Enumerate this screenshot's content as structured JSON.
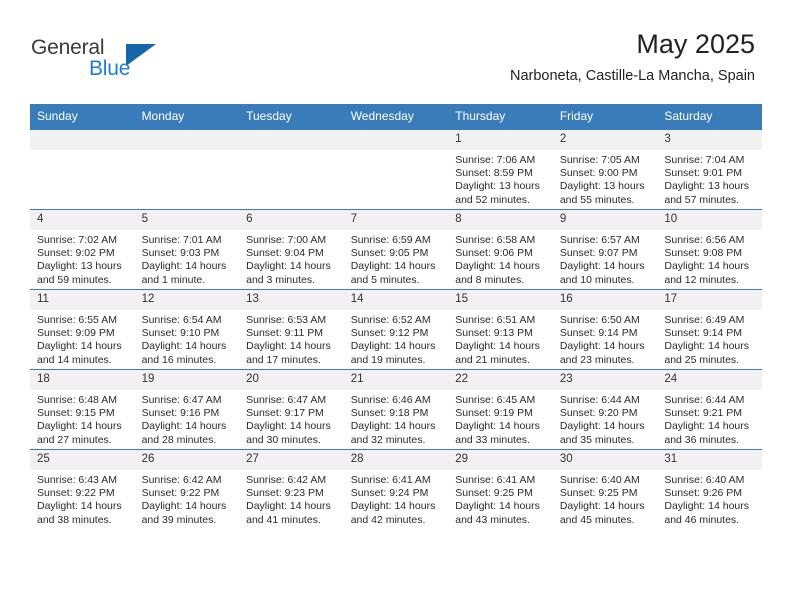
{
  "brand": {
    "name_part1": "General",
    "name_part2": "Blue",
    "accent_color": "#1f7fd0",
    "triangle_color": "#1665a8"
  },
  "header": {
    "title": "May 2025",
    "subtitle": "Narboneta, Castille-La Mancha, Spain"
  },
  "theme": {
    "header_row_color": "#3a7cba",
    "daynum_band_color": "#f1f1f1"
  },
  "weekdays": [
    "Sunday",
    "Monday",
    "Tuesday",
    "Wednesday",
    "Thursday",
    "Friday",
    "Saturday"
  ],
  "labels": {
    "sunrise_prefix": "Sunrise:",
    "sunset_prefix": "Sunset:",
    "daylight_prefix": "Daylight:"
  },
  "weeks": [
    [
      {
        "day": "",
        "empty": true
      },
      {
        "day": "",
        "empty": true
      },
      {
        "day": "",
        "empty": true
      },
      {
        "day": "",
        "empty": true
      },
      {
        "day": "1",
        "sunrise": "Sunrise: 7:06 AM",
        "sunset": "Sunset: 8:59 PM",
        "daylight_line1": "Daylight: 13 hours",
        "daylight_line2": "and 52 minutes."
      },
      {
        "day": "2",
        "sunrise": "Sunrise: 7:05 AM",
        "sunset": "Sunset: 9:00 PM",
        "daylight_line1": "Daylight: 13 hours",
        "daylight_line2": "and 55 minutes."
      },
      {
        "day": "3",
        "sunrise": "Sunrise: 7:04 AM",
        "sunset": "Sunset: 9:01 PM",
        "daylight_line1": "Daylight: 13 hours",
        "daylight_line2": "and 57 minutes."
      }
    ],
    [
      {
        "day": "4",
        "sunrise": "Sunrise: 7:02 AM",
        "sunset": "Sunset: 9:02 PM",
        "daylight_line1": "Daylight: 13 hours",
        "daylight_line2": "and 59 minutes."
      },
      {
        "day": "5",
        "sunrise": "Sunrise: 7:01 AM",
        "sunset": "Sunset: 9:03 PM",
        "daylight_line1": "Daylight: 14 hours",
        "daylight_line2": "and 1 minute."
      },
      {
        "day": "6",
        "sunrise": "Sunrise: 7:00 AM",
        "sunset": "Sunset: 9:04 PM",
        "daylight_line1": "Daylight: 14 hours",
        "daylight_line2": "and 3 minutes."
      },
      {
        "day": "7",
        "sunrise": "Sunrise: 6:59 AM",
        "sunset": "Sunset: 9:05 PM",
        "daylight_line1": "Daylight: 14 hours",
        "daylight_line2": "and 5 minutes."
      },
      {
        "day": "8",
        "sunrise": "Sunrise: 6:58 AM",
        "sunset": "Sunset: 9:06 PM",
        "daylight_line1": "Daylight: 14 hours",
        "daylight_line2": "and 8 minutes."
      },
      {
        "day": "9",
        "sunrise": "Sunrise: 6:57 AM",
        "sunset": "Sunset: 9:07 PM",
        "daylight_line1": "Daylight: 14 hours",
        "daylight_line2": "and 10 minutes."
      },
      {
        "day": "10",
        "sunrise": "Sunrise: 6:56 AM",
        "sunset": "Sunset: 9:08 PM",
        "daylight_line1": "Daylight: 14 hours",
        "daylight_line2": "and 12 minutes."
      }
    ],
    [
      {
        "day": "11",
        "sunrise": "Sunrise: 6:55 AM",
        "sunset": "Sunset: 9:09 PM",
        "daylight_line1": "Daylight: 14 hours",
        "daylight_line2": "and 14 minutes."
      },
      {
        "day": "12",
        "sunrise": "Sunrise: 6:54 AM",
        "sunset": "Sunset: 9:10 PM",
        "daylight_line1": "Daylight: 14 hours",
        "daylight_line2": "and 16 minutes."
      },
      {
        "day": "13",
        "sunrise": "Sunrise: 6:53 AM",
        "sunset": "Sunset: 9:11 PM",
        "daylight_line1": "Daylight: 14 hours",
        "daylight_line2": "and 17 minutes."
      },
      {
        "day": "14",
        "sunrise": "Sunrise: 6:52 AM",
        "sunset": "Sunset: 9:12 PM",
        "daylight_line1": "Daylight: 14 hours",
        "daylight_line2": "and 19 minutes."
      },
      {
        "day": "15",
        "sunrise": "Sunrise: 6:51 AM",
        "sunset": "Sunset: 9:13 PM",
        "daylight_line1": "Daylight: 14 hours",
        "daylight_line2": "and 21 minutes."
      },
      {
        "day": "16",
        "sunrise": "Sunrise: 6:50 AM",
        "sunset": "Sunset: 9:14 PM",
        "daylight_line1": "Daylight: 14 hours",
        "daylight_line2": "and 23 minutes."
      },
      {
        "day": "17",
        "sunrise": "Sunrise: 6:49 AM",
        "sunset": "Sunset: 9:14 PM",
        "daylight_line1": "Daylight: 14 hours",
        "daylight_line2": "and 25 minutes."
      }
    ],
    [
      {
        "day": "18",
        "sunrise": "Sunrise: 6:48 AM",
        "sunset": "Sunset: 9:15 PM",
        "daylight_line1": "Daylight: 14 hours",
        "daylight_line2": "and 27 minutes."
      },
      {
        "day": "19",
        "sunrise": "Sunrise: 6:47 AM",
        "sunset": "Sunset: 9:16 PM",
        "daylight_line1": "Daylight: 14 hours",
        "daylight_line2": "and 28 minutes."
      },
      {
        "day": "20",
        "sunrise": "Sunrise: 6:47 AM",
        "sunset": "Sunset: 9:17 PM",
        "daylight_line1": "Daylight: 14 hours",
        "daylight_line2": "and 30 minutes."
      },
      {
        "day": "21",
        "sunrise": "Sunrise: 6:46 AM",
        "sunset": "Sunset: 9:18 PM",
        "daylight_line1": "Daylight: 14 hours",
        "daylight_line2": "and 32 minutes."
      },
      {
        "day": "22",
        "sunrise": "Sunrise: 6:45 AM",
        "sunset": "Sunset: 9:19 PM",
        "daylight_line1": "Daylight: 14 hours",
        "daylight_line2": "and 33 minutes."
      },
      {
        "day": "23",
        "sunrise": "Sunrise: 6:44 AM",
        "sunset": "Sunset: 9:20 PM",
        "daylight_line1": "Daylight: 14 hours",
        "daylight_line2": "and 35 minutes."
      },
      {
        "day": "24",
        "sunrise": "Sunrise: 6:44 AM",
        "sunset": "Sunset: 9:21 PM",
        "daylight_line1": "Daylight: 14 hours",
        "daylight_line2": "and 36 minutes."
      }
    ],
    [
      {
        "day": "25",
        "sunrise": "Sunrise: 6:43 AM",
        "sunset": "Sunset: 9:22 PM",
        "daylight_line1": "Daylight: 14 hours",
        "daylight_line2": "and 38 minutes."
      },
      {
        "day": "26",
        "sunrise": "Sunrise: 6:42 AM",
        "sunset": "Sunset: 9:22 PM",
        "daylight_line1": "Daylight: 14 hours",
        "daylight_line2": "and 39 minutes."
      },
      {
        "day": "27",
        "sunrise": "Sunrise: 6:42 AM",
        "sunset": "Sunset: 9:23 PM",
        "daylight_line1": "Daylight: 14 hours",
        "daylight_line2": "and 41 minutes."
      },
      {
        "day": "28",
        "sunrise": "Sunrise: 6:41 AM",
        "sunset": "Sunset: 9:24 PM",
        "daylight_line1": "Daylight: 14 hours",
        "daylight_line2": "and 42 minutes."
      },
      {
        "day": "29",
        "sunrise": "Sunrise: 6:41 AM",
        "sunset": "Sunset: 9:25 PM",
        "daylight_line1": "Daylight: 14 hours",
        "daylight_line2": "and 43 minutes."
      },
      {
        "day": "30",
        "sunrise": "Sunrise: 6:40 AM",
        "sunset": "Sunset: 9:25 PM",
        "daylight_line1": "Daylight: 14 hours",
        "daylight_line2": "and 45 minutes."
      },
      {
        "day": "31",
        "sunrise": "Sunrise: 6:40 AM",
        "sunset": "Sunset: 9:26 PM",
        "daylight_line1": "Daylight: 14 hours",
        "daylight_line2": "and 46 minutes."
      }
    ]
  ]
}
